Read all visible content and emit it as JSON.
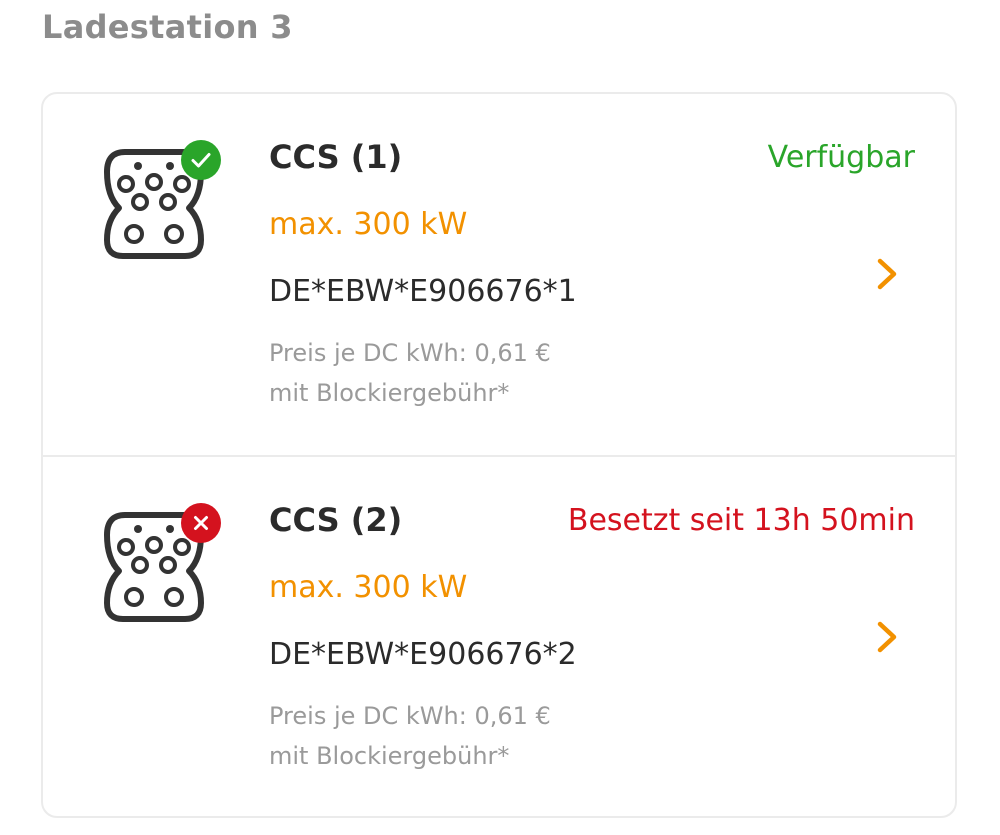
{
  "station": {
    "title": "Ladestation 3"
  },
  "colors": {
    "accent": "#f29100",
    "available": "#2aa52a",
    "occupied": "#d4121e",
    "icon_stroke": "#333333",
    "muted_text": "#9a9a9a"
  },
  "connectors": [
    {
      "name": "CCS (1)",
      "status": "Verfügbar",
      "status_kind": "available",
      "status_icon": "check-icon",
      "plug_icon": "ccs-plug-icon",
      "power": "max. 300 kW",
      "evse_id": "DE*EBW*E906676*1",
      "price": "Preis je DC kWh: 0,61 €",
      "fee_note": "mit Blockiergebühr*"
    },
    {
      "name": "CCS (2)",
      "status": "Besetzt seit 13h 50min",
      "status_kind": "occupied",
      "status_icon": "cross-icon",
      "plug_icon": "ccs-plug-icon",
      "power": "max. 300 kW",
      "evse_id": "DE*EBW*E906676*2",
      "price": "Preis je DC kWh: 0,61 €",
      "fee_note": "mit Blockiergebühr*"
    }
  ]
}
